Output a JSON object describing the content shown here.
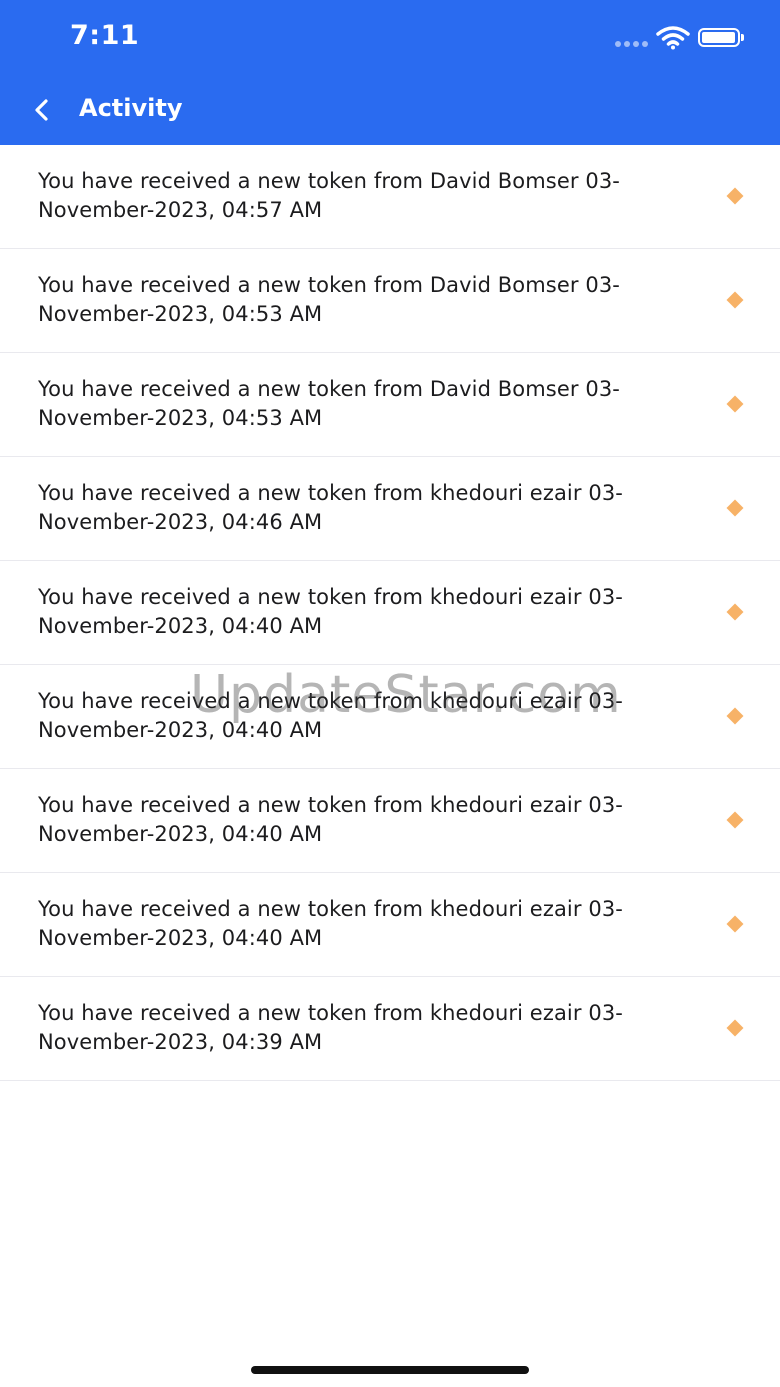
{
  "status_bar": {
    "time": "7:11"
  },
  "nav": {
    "title": "Activity",
    "back_icon": "chevron-left-icon"
  },
  "activity": [
    {
      "text": "You have received a new token from David Bomser  03-November-2023, 04:57 AM"
    },
    {
      "text": "You have received a new token from David Bomser  03-November-2023, 04:53 AM"
    },
    {
      "text": "You have received a new token from David Bomser  03-November-2023, 04:53 AM"
    },
    {
      "text": "You have received a new token from khedouri ezair  03-November-2023, 04:46 AM"
    },
    {
      "text": "You have received a new token from khedouri ezair  03-November-2023, 04:40 AM"
    },
    {
      "text": "You have received a new token from khedouri ezair  03-November-2023, 04:40 AM"
    },
    {
      "text": "You have received a new token from khedouri ezair  03-November-2023, 04:40 AM"
    },
    {
      "text": "You have received a new token from khedouri ezair  03-November-2023, 04:40 AM"
    },
    {
      "text": "You have received a new token from khedouri ezair  03-November-2023, 04:39 AM"
    }
  ],
  "watermark": "UpdateStar.com",
  "colors": {
    "header": "#2a6bf0",
    "diamond": "#f7b267"
  }
}
